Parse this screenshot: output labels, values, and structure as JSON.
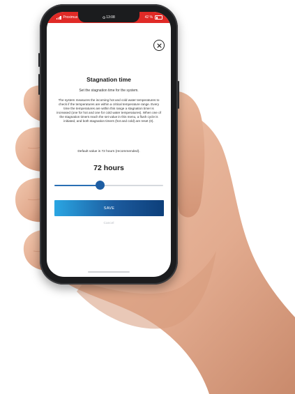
{
  "status_bar": {
    "carrier": "Proximus",
    "time": "13:08",
    "battery": "42 %",
    "battery_level": 0.42,
    "color": "#e02a26"
  },
  "icons": {
    "close": "close-icon",
    "wifi": "wifi-icon",
    "signal": "signal-icon",
    "battery": "battery-icon",
    "alarm": "alarm-icon"
  },
  "dialog": {
    "title": "Stagnation time",
    "subtitle": "Set the stagnation time for the system.",
    "description": "The system measures the incoming hot and cold water temperatures to check if the temperatures are within a critical temperature range. Every time the temperatures are within this range a stagnation timer is increased (one for hot and one for cold water temperatures). When one of the stagnation timers reach the set value in this menu, a flush cycle is initiated, and both stagnation timers (hot and cold) are reset (0).",
    "default_note": "Default value is 72 hours (recommended).",
    "value_display": "72 hours",
    "slider": {
      "level_fraction": 0.42,
      "track_color": "#d6d9de",
      "fill_color": "#2a6fb4"
    },
    "save_label": "SAVE",
    "cancel_label": "Cancel"
  },
  "colors": {
    "accent": "#1e5ea3",
    "save_gradient_start": "#2aa6e3",
    "save_gradient_end": "#0d3f7a"
  }
}
